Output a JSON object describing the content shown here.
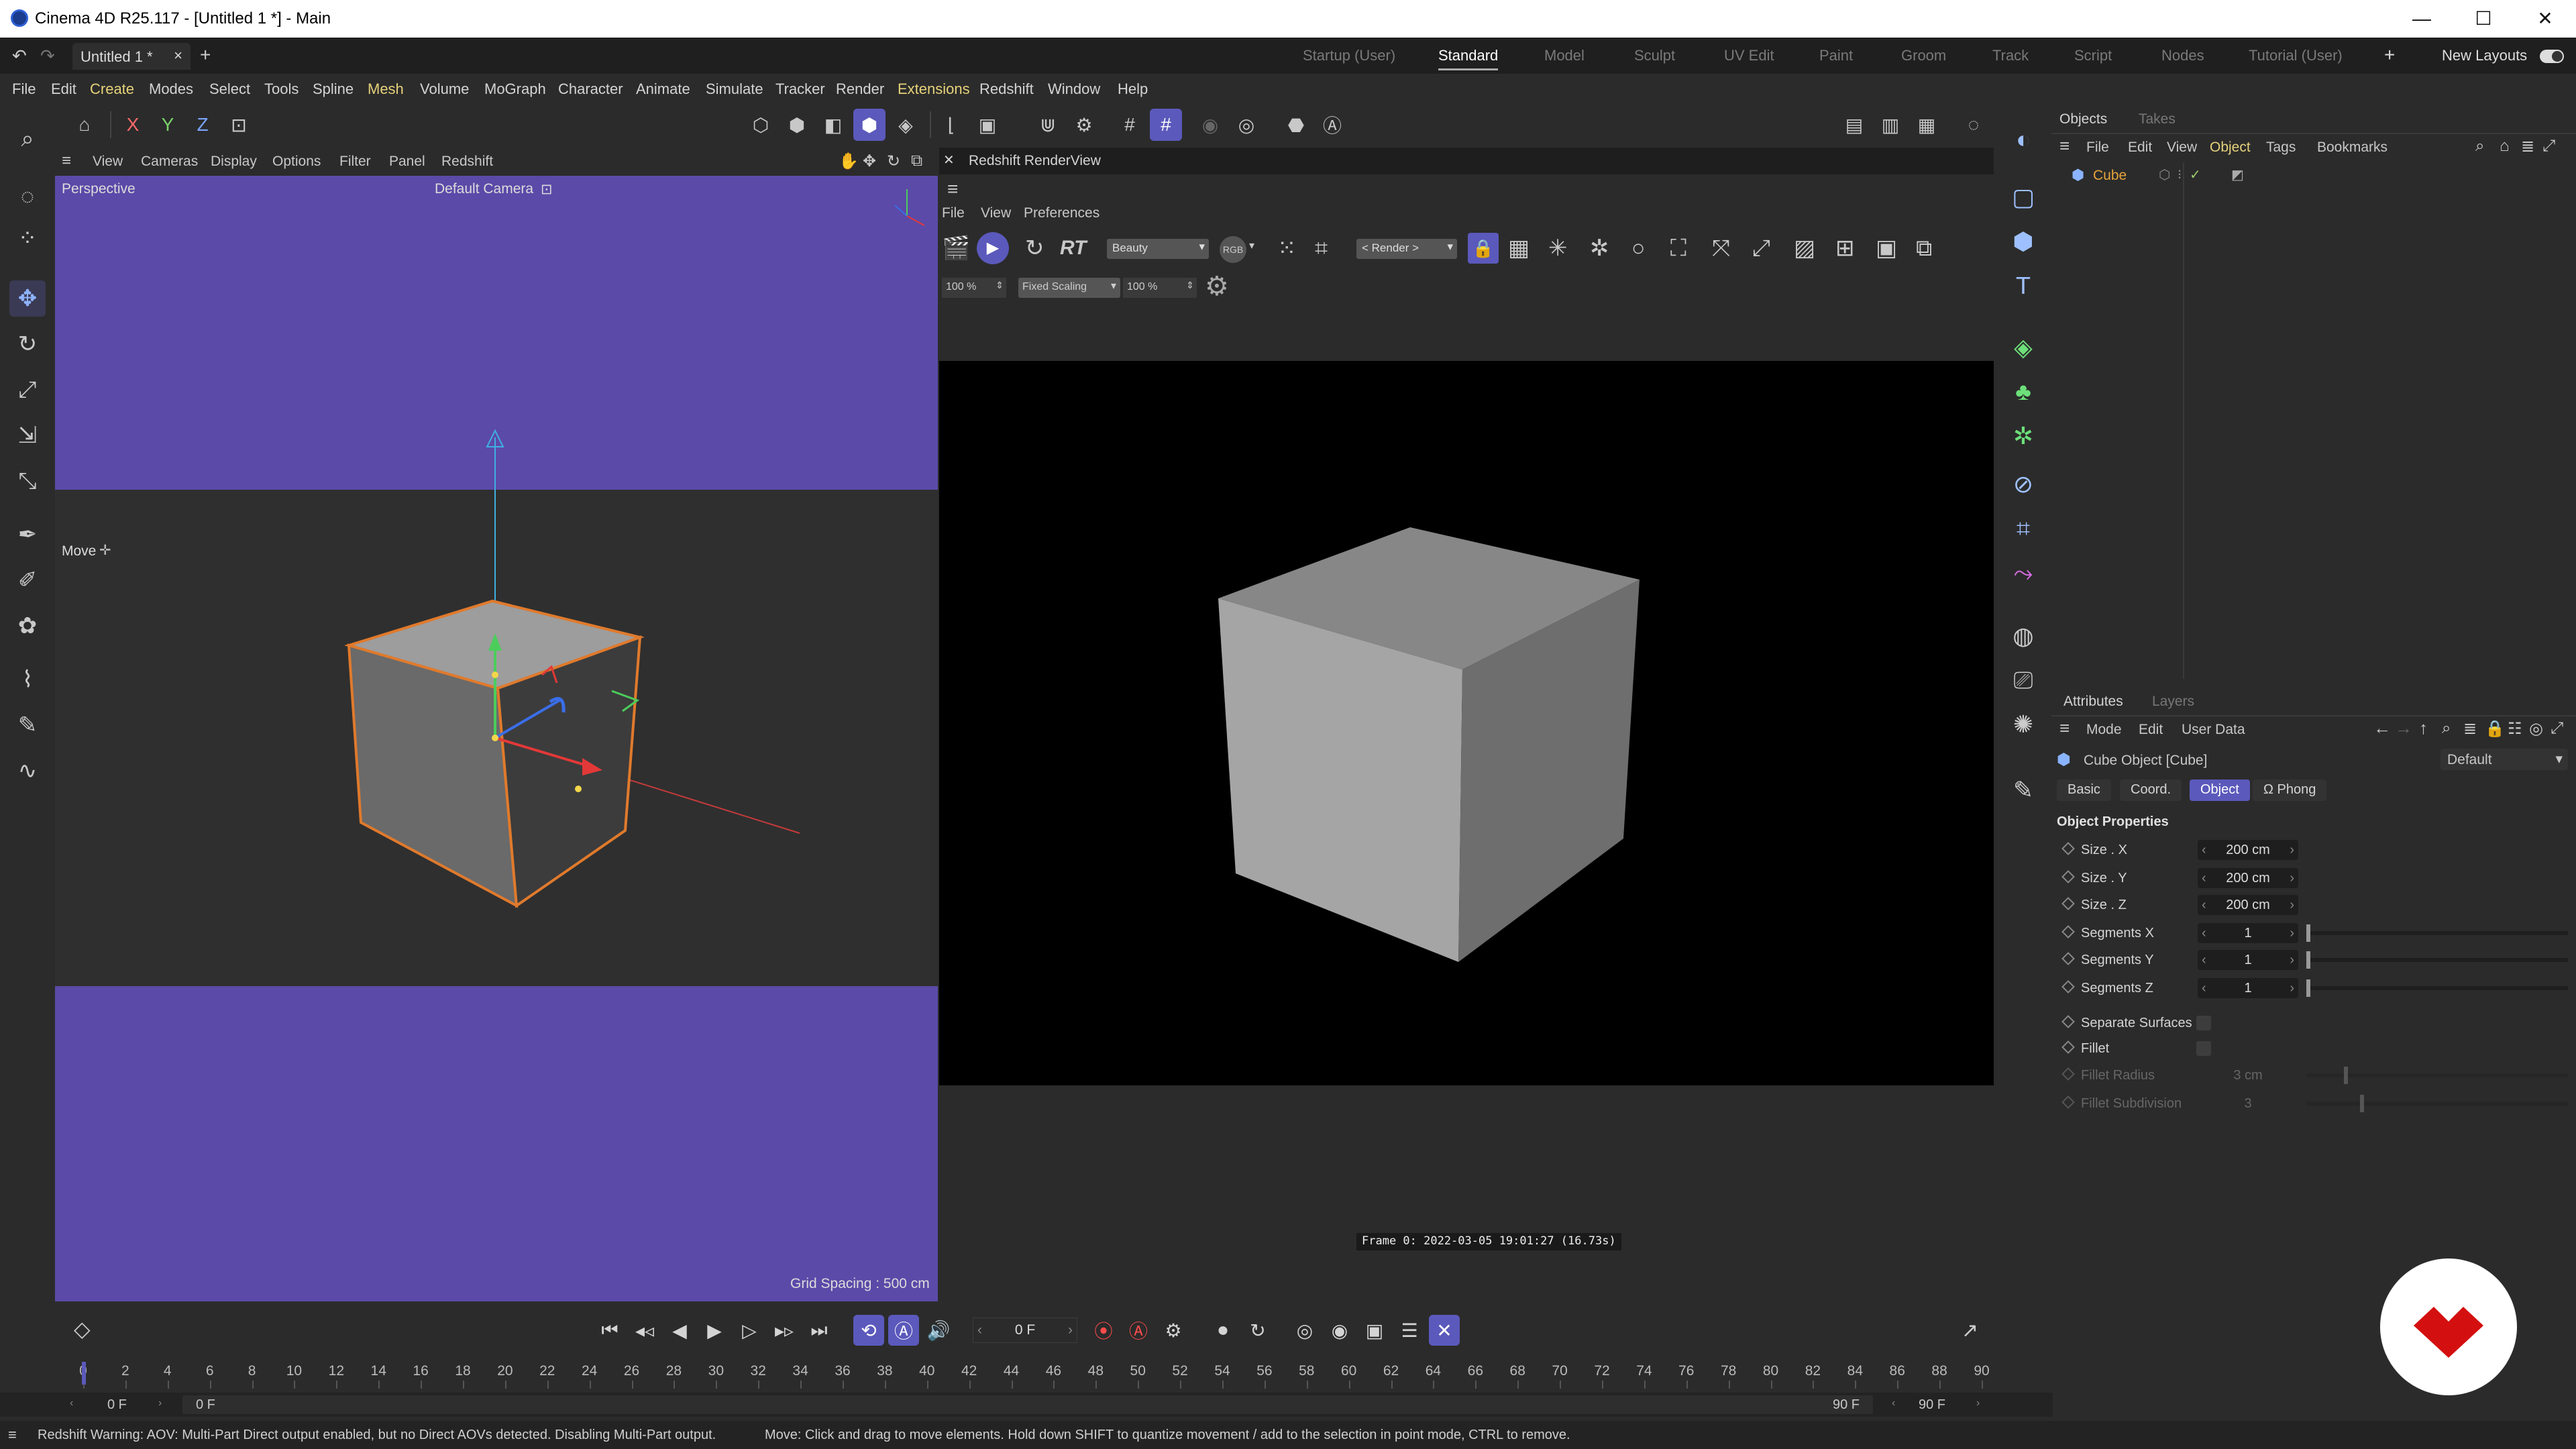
{
  "window": {
    "title": "Cinema 4D R25.117 - [Untitled 1 *] - Main",
    "minimize": "—",
    "maximize": "☐",
    "close": "✕"
  },
  "tabbar": {
    "doc_tab": "Untitled 1 *",
    "doc_tab_close": "×",
    "add": "+",
    "layouts": [
      "Startup (User)",
      "Standard",
      "Model",
      "Sculpt",
      "UV Edit",
      "Paint",
      "Groom",
      "Track",
      "Script",
      "Nodes",
      "Tutorial (User)"
    ],
    "active_layout": "Standard",
    "new_layouts": "New Layouts"
  },
  "menubar": {
    "items": [
      "File",
      "Edit",
      "Create",
      "Modes",
      "Select",
      "Tools",
      "Spline",
      "Mesh",
      "Volume",
      "MoGraph",
      "Character",
      "Animate",
      "Simulate",
      "Tracker",
      "Render",
      "Extensions",
      "Redshift",
      "Window",
      "Help"
    ],
    "accent_items": [
      "Create",
      "Mesh",
      "Extensions"
    ]
  },
  "toolbar": {
    "axis_x": "X",
    "axis_y": "Y",
    "axis_z": "Z"
  },
  "viewport": {
    "menu": [
      "View",
      "Cameras",
      "Display",
      "Options",
      "Filter",
      "Panel",
      "Redshift"
    ],
    "label": "Perspective",
    "camera": "Default Camera",
    "camera_icon": "⊡",
    "tool_label": "Move",
    "tool_icon": "✛",
    "grid_spacing": "Grid Spacing : 500 cm",
    "sky_color": "#5b4aa8",
    "floor_color": "#2f2f2f"
  },
  "renderview": {
    "title": "Redshift RenderView",
    "close": "✕",
    "menu": [
      "File",
      "View",
      "Preferences"
    ],
    "rt": "RT",
    "aov": "Beauty",
    "rgb": "RGB",
    "render_select": "< Render >",
    "zoom1": "100 %",
    "scaling": "Fixed Scaling",
    "zoom2": "100 %",
    "frame_info": "Frame  0:  2022-03-05  19:01:27  (16.73s)"
  },
  "objects": {
    "tabs": [
      "Objects",
      "Takes"
    ],
    "menu": [
      "File",
      "Edit",
      "View",
      "Object",
      "Tags",
      "Bookmarks"
    ],
    "items": [
      {
        "name": "Cube",
        "color": "#e8a33c"
      }
    ]
  },
  "attributes": {
    "tabs": [
      "Attributes",
      "Layers"
    ],
    "menu": [
      "Mode",
      "Edit",
      "User Data"
    ],
    "object_name": "Cube Object [Cube]",
    "preset": "Default",
    "subtabs": [
      "Basic",
      "Coord.",
      "Object",
      "Ω Phong"
    ],
    "active_subtab": "Object",
    "section": "Object Properties",
    "rows": [
      {
        "label": "Size . X",
        "value": "200 cm"
      },
      {
        "label": "Size . Y",
        "value": "200 cm"
      },
      {
        "label": "Size . Z",
        "value": "200 cm"
      },
      {
        "label": "Segments X",
        "value": "1"
      },
      {
        "label": "Segments Y",
        "value": "1"
      },
      {
        "label": "Segments Z",
        "value": "1"
      }
    ],
    "separate_surfaces": "Separate Surfaces",
    "fillet": "Fillet",
    "fillet_radius": {
      "label": "Fillet Radius",
      "value": "3 cm"
    },
    "fillet_subdivision": {
      "label": "Fillet Subdivision",
      "value": "3"
    }
  },
  "timeline": {
    "current_frame": "0 F",
    "ticks": [
      "0",
      "2",
      "4",
      "6",
      "8",
      "10",
      "12",
      "14",
      "16",
      "18",
      "20",
      "22",
      "24",
      "26",
      "28",
      "30",
      "32",
      "34",
      "36",
      "38",
      "40",
      "42",
      "44",
      "46",
      "48",
      "50",
      "52",
      "54",
      "56",
      "58",
      "60",
      "62",
      "64",
      "66",
      "68",
      "70",
      "72",
      "74",
      "76",
      "78",
      "80",
      "82",
      "84",
      "86",
      "88",
      "90"
    ],
    "start": "0 F",
    "start2": "0 F",
    "end": "90 F",
    "end2": "90 F"
  },
  "statusbar": {
    "warning": "Redshift Warning: AOV: Multi-Part Direct output enabled, but no Direct AOVs detected. Disabling Multi-Part output.",
    "hint": "Move: Click and drag to move elements. Hold down SHIFT to quantize movement / add to the selection in point mode, CTRL to remove."
  },
  "colors": {
    "accent": "#5b59bb",
    "menu_accent": "#e6d27a",
    "brand_logo": "#d40f0f"
  }
}
